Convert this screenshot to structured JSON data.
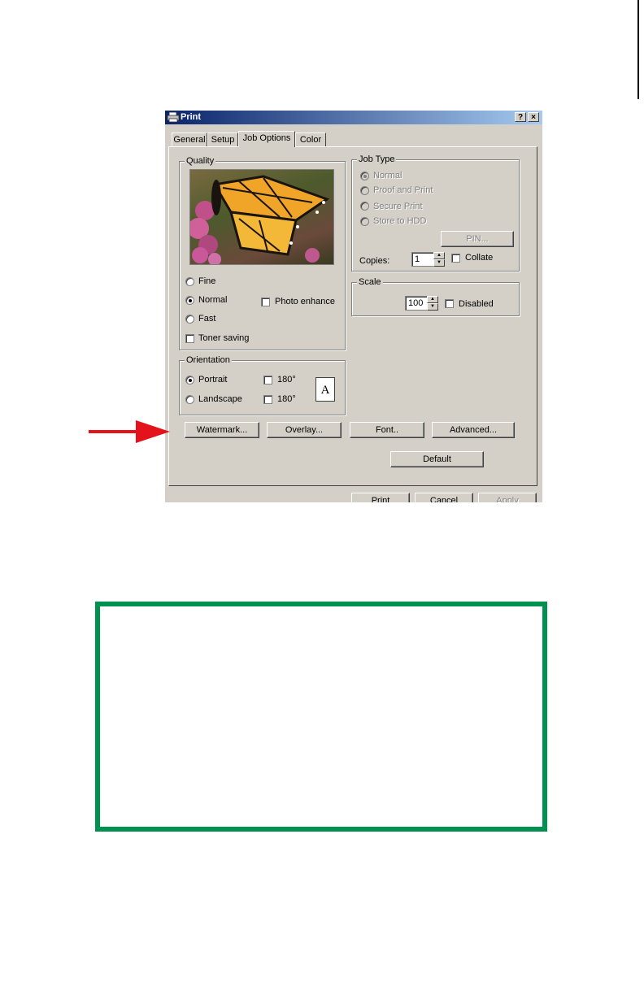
{
  "window": {
    "title": "Print",
    "help_label": "?",
    "close_label": "×",
    "icon": "printer-icon"
  },
  "tabs": [
    {
      "label": "General"
    },
    {
      "label": "Setup"
    },
    {
      "label": "Job Options",
      "active": true
    },
    {
      "label": "Color"
    }
  ],
  "quality": {
    "title": "Quality",
    "preview_icon": "butterfly-photo",
    "options": [
      {
        "label": "Fine",
        "selected": false
      },
      {
        "label": "Normal",
        "selected": true
      },
      {
        "label": "Fast",
        "selected": false
      }
    ],
    "photo_enhance_label": "Photo enhance",
    "toner_saving_label": "Toner saving"
  },
  "job_type": {
    "title": "Job Type",
    "options": [
      {
        "label": "Normal",
        "selected": true
      },
      {
        "label": "Proof and Print",
        "selected": false
      },
      {
        "label": "Secure Print",
        "selected": false
      },
      {
        "label": "Store to HDD",
        "selected": false
      }
    ],
    "pin_label": "PIN...",
    "copies_label": "Copies:",
    "copies_value": "1",
    "collate_label": "Collate"
  },
  "scale": {
    "title": "Scale",
    "value": "100",
    "disabled_label": "Disabled"
  },
  "orientation": {
    "title": "Orientation",
    "portrait_label": "Portrait",
    "landscape_label": "Landscape",
    "rotate_label_1": "180°",
    "rotate_label_2": "180°",
    "page_icon_letter": "A"
  },
  "buttons": {
    "watermark": "Watermark...",
    "overlay": "Overlay...",
    "font": "Font..",
    "advanced": "Advanced...",
    "default": "Default"
  },
  "footer": {
    "print": "Print",
    "cancel": "Cancel",
    "apply": "Apply"
  },
  "colors": {
    "arrow": "#e3121b",
    "note_border": "#009050",
    "dialog_face": "#d4d0c8",
    "title_bar": "#0a246a"
  }
}
